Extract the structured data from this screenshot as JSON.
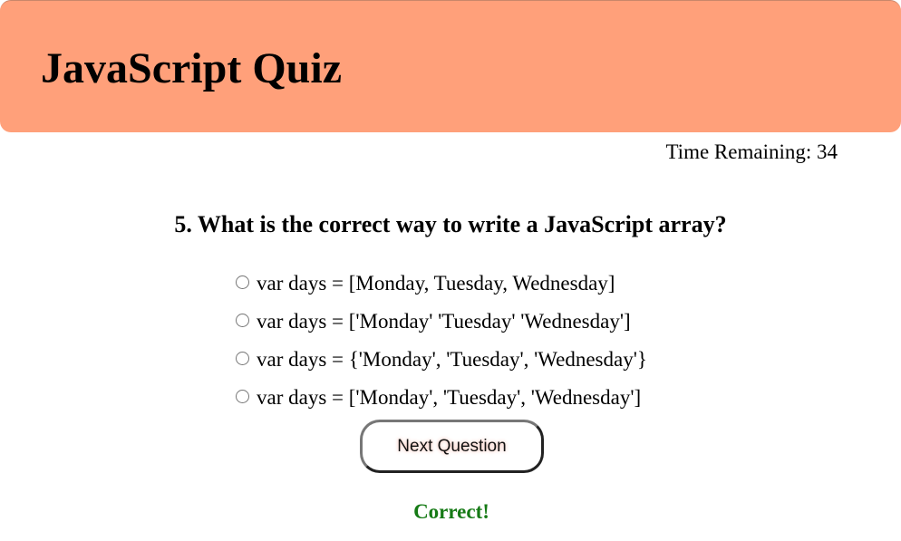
{
  "header": {
    "title": "JavaScript Quiz",
    "background_color": "#FFA07A"
  },
  "timer": {
    "text": "Time Remaining: 34"
  },
  "question": {
    "text": "5. What is the correct way to write a JavaScript array?"
  },
  "choices": [
    {
      "label": "var days = [Monday, Tuesday, Wednesday]",
      "selected": false
    },
    {
      "label": "var days = ['Monday' 'Tuesday' 'Wednesday']",
      "selected": false
    },
    {
      "label": "var days = {'Monday', 'Tuesday', 'Wednesday'}",
      "selected": false
    },
    {
      "label": "var days = ['Monday', 'Tuesday', 'Wednesday']",
      "selected": false
    }
  ],
  "next_button": {
    "label": "Next Question"
  },
  "feedback": {
    "text": "Correct!",
    "color": "#157a15"
  }
}
